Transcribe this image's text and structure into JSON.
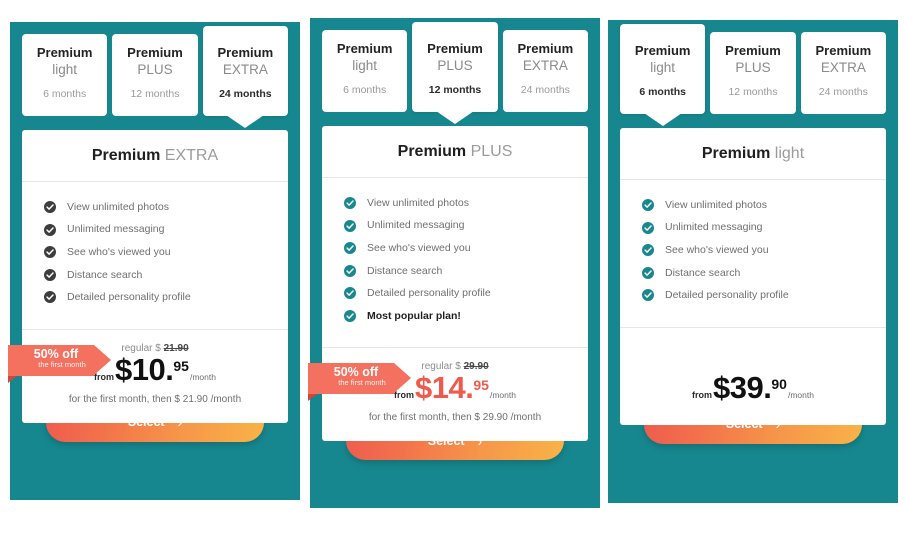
{
  "colors": {
    "teal": "#17878f",
    "coral": "#f4705f",
    "price_red": "#ef5a4c",
    "check_dark": "#3d3d3d",
    "check_teal": "#17888f"
  },
  "tab_labels": {
    "brand": "Premium",
    "tiers": [
      "light",
      "PLUS",
      "EXTRA"
    ],
    "durations": [
      "6 months",
      "12 months",
      "24 months"
    ]
  },
  "select_label": "Select",
  "chevron": "›",
  "panels": [
    {
      "active_index": 2,
      "header": {
        "brand": "Premium",
        "tier": "EXTRA"
      },
      "check_color": "#3d3d3d",
      "features": [
        {
          "label": "View unlimited photos",
          "highlight": false
        },
        {
          "label": "Unlimited messaging",
          "highlight": false
        },
        {
          "label": "See who's viewed you",
          "highlight": false
        },
        {
          "label": "Distance search",
          "highlight": false
        },
        {
          "label": "Detailed personality profile",
          "highlight": false
        }
      ],
      "badge": {
        "line1": "50% off",
        "line2": "the first month"
      },
      "price": {
        "regular_prefix": "regular $ ",
        "regular_amount": "21.90",
        "from": "from",
        "amount": "$10.",
        "cents": "95",
        "per": "/month",
        "theme": "theme-dark",
        "note": "for the first month, then $ 21.90 /month"
      }
    },
    {
      "active_index": 1,
      "header": {
        "brand": "Premium",
        "tier": "PLUS"
      },
      "check_color": "#17888f",
      "features": [
        {
          "label": "View unlimited photos",
          "highlight": false
        },
        {
          "label": "Unlimited messaging",
          "highlight": false
        },
        {
          "label": "See who's viewed you",
          "highlight": false
        },
        {
          "label": "Distance search",
          "highlight": false
        },
        {
          "label": "Detailed personality profile",
          "highlight": false
        },
        {
          "label": "Most popular plan!",
          "highlight": true
        }
      ],
      "badge": {
        "line1": "50% off",
        "line2": "the first month"
      },
      "price": {
        "regular_prefix": "regular $ ",
        "regular_amount": "29.90",
        "from": "from",
        "amount": "$14.",
        "cents": "95",
        "per": "/month",
        "theme": "theme-red",
        "note": "for the first month, then $ 29.90 /month"
      }
    },
    {
      "active_index": 0,
      "header": {
        "brand": "Premium",
        "tier": "light"
      },
      "check_color": "#17888f",
      "features": [
        {
          "label": "View unlimited photos",
          "highlight": false
        },
        {
          "label": "Unlimited messaging",
          "highlight": false
        },
        {
          "label": "See who's viewed you",
          "highlight": false
        },
        {
          "label": "Distance search",
          "highlight": false
        },
        {
          "label": "Detailed personality profile",
          "highlight": false
        }
      ],
      "badge": null,
      "price": {
        "regular_prefix": "",
        "regular_amount": "",
        "from": "from",
        "amount": "$39.",
        "cents": "90",
        "per": "/month",
        "theme": "theme-dark",
        "note": ""
      }
    }
  ]
}
